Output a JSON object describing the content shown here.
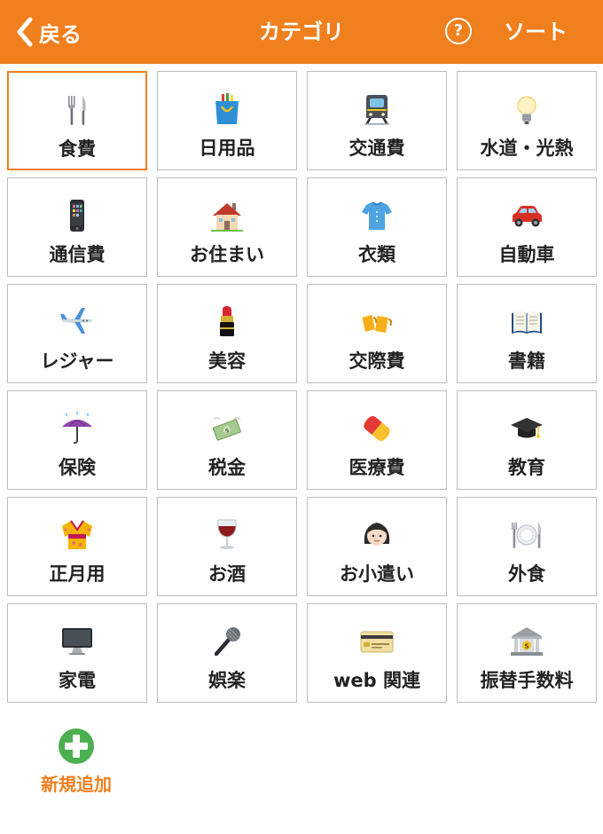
{
  "header": {
    "back_label": "戻る",
    "title": "カテゴリ",
    "help_label": "?",
    "sort_label": "ソート"
  },
  "colors": {
    "accent": "#f07f1d",
    "cell_border": "#bdbdbd",
    "add_green": "#4caf50"
  },
  "categories": [
    {
      "label": "食費",
      "icon": "fork-knife-icon",
      "selected": true
    },
    {
      "label": "日用品",
      "icon": "shopping-bag-icon"
    },
    {
      "label": "交通費",
      "icon": "train-icon"
    },
    {
      "label": "水道・光熱",
      "icon": "light-bulb-icon"
    },
    {
      "label": "通信費",
      "icon": "mobile-phone-icon"
    },
    {
      "label": "お住まい",
      "icon": "house-icon"
    },
    {
      "label": "衣類",
      "icon": "shirt-icon"
    },
    {
      "label": "自動車",
      "icon": "car-icon"
    },
    {
      "label": "レジャー",
      "icon": "airplane-icon"
    },
    {
      "label": "美容",
      "icon": "lipstick-icon"
    },
    {
      "label": "交際費",
      "icon": "beer-mugs-icon"
    },
    {
      "label": "書籍",
      "icon": "open-book-icon"
    },
    {
      "label": "保険",
      "icon": "umbrella-rain-icon"
    },
    {
      "label": "税金",
      "icon": "money-wings-icon"
    },
    {
      "label": "医療費",
      "icon": "pill-icon"
    },
    {
      "label": "教育",
      "icon": "graduation-cap-icon"
    },
    {
      "label": "正月用",
      "icon": "kimono-icon"
    },
    {
      "label": "お酒",
      "icon": "wine-glass-icon"
    },
    {
      "label": "お小遣い",
      "icon": "girl-icon"
    },
    {
      "label": "外食",
      "icon": "plate-cutlery-icon"
    },
    {
      "label": "家電",
      "icon": "desktop-computer-icon"
    },
    {
      "label": "娯楽",
      "icon": "microphone-icon"
    },
    {
      "label": "web 関連",
      "icon": "credit-card-icon"
    },
    {
      "label": "振替手数料",
      "icon": "bank-icon"
    }
  ],
  "add_new": {
    "label": "新規追加",
    "icon": "plus-circle-icon"
  }
}
